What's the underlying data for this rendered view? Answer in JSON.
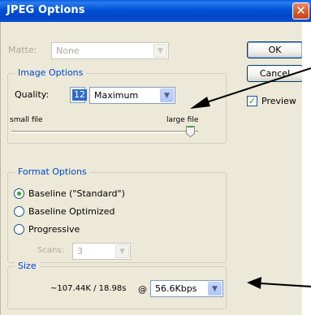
{
  "window": {
    "title": "JPEG Options",
    "close_glyph": "✕"
  },
  "matte": {
    "label": "Matte:",
    "value": "None"
  },
  "image_options": {
    "title": "Image Options",
    "quality_label": "Quality:",
    "quality_value": "12",
    "quality_preset": "Maximum",
    "small_label": "small file",
    "large_label": "large file",
    "quality_level": 1.0
  },
  "format_options": {
    "title": "Format Options",
    "options": [
      "Baseline (\"Standard\")",
      "Baseline Optimized",
      "Progressive"
    ],
    "selected_index": 0,
    "scans_label": "Scans:",
    "scans_value": "3"
  },
  "size": {
    "title": "Size",
    "estimate": "~107.44K / 18.98s",
    "at": "@",
    "speed": "56.6Kbps"
  },
  "buttons": {
    "ok": "OK",
    "cancel": "Cancel"
  },
  "preview": {
    "label": "Preview",
    "checked": true
  },
  "colors": {
    "accent": "#0046d5",
    "titlebar": "#0052d6",
    "close": "#d65a2b"
  }
}
